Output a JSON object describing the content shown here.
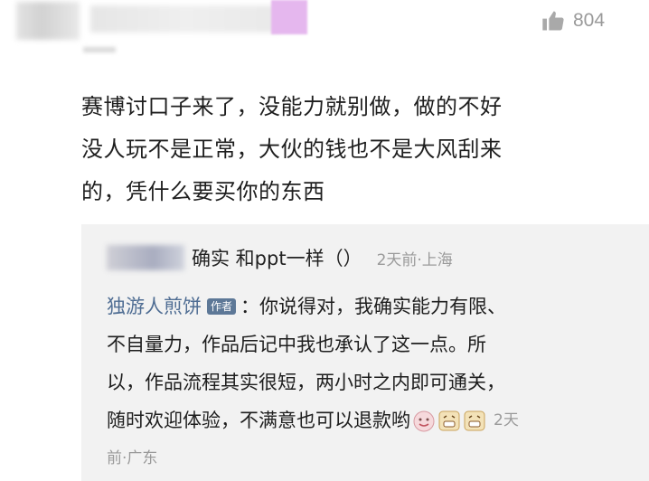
{
  "like": {
    "count": "804",
    "icon": "thumbs-up-icon"
  },
  "comment": {
    "lines": [
      "赛博讨口子来了，没能力就别做，做的不好",
      "没人玩不是正常，大伙的钱也不是大风刮来",
      "的，凭什么要买你的东西"
    ]
  },
  "reply1": {
    "text": "确实 和ppt一样（）",
    "meta": "2天前·上海"
  },
  "reply2": {
    "author": "独游人煎饼",
    "badge": "作者",
    "lines": [
      "：你说得对，我确实能力有限、",
      "不自量力，作品后记中我也承认了这一点。所",
      "以，作品流程其实很短，两小时之内即可通关，",
      "随时欢迎体验，不满意也可以退款哟"
    ],
    "meta_part1": "2天",
    "meta_part2": "前·广东",
    "emojis": [
      "happy-face-icon",
      "grin-face-icon",
      "grin-face-icon"
    ]
  }
}
